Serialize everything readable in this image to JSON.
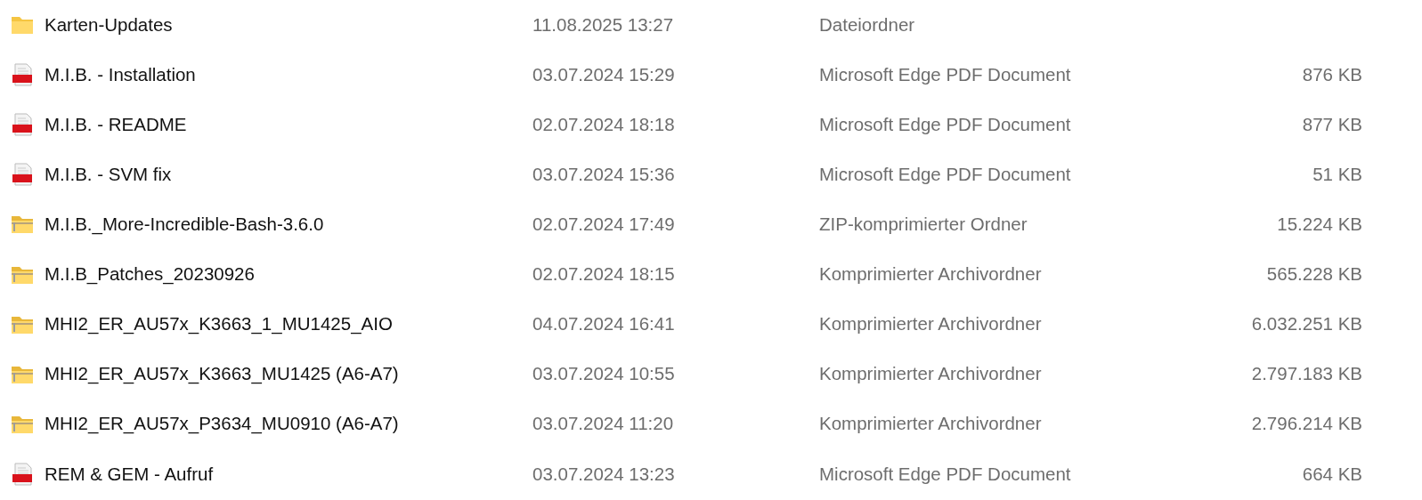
{
  "files": [
    {
      "kind": "folder",
      "name": "Karten-Updates",
      "date": "11.08.2025 13:27",
      "type": "Dateiordner"
    },
    {
      "kind": "pdf",
      "name": "M.I.B. - Installation",
      "date": "03.07.2024 15:29",
      "type": "Microsoft Edge PDF Document",
      "size": "876 KB"
    },
    {
      "kind": "pdf",
      "name": "M.I.B. - README",
      "date": "02.07.2024 18:18",
      "type": "Microsoft Edge PDF Document",
      "size": "877 KB"
    },
    {
      "kind": "pdf",
      "name": "M.I.B. - SVM fix",
      "date": "03.07.2024 15:36",
      "type": "Microsoft Edge PDF Document",
      "size": "51 KB"
    },
    {
      "kind": "zip",
      "name": "M.I.B._More-Incredible-Bash-3.6.0",
      "date": "02.07.2024 17:49",
      "type": "ZIP-komprimierter Ordner",
      "size": "15.224 KB"
    },
    {
      "kind": "zip",
      "name": "M.I.B_Patches_20230926",
      "date": "02.07.2024 18:15",
      "type": "Komprimierter Archivordner",
      "size": "565.228 KB"
    },
    {
      "kind": "zip",
      "name": "MHI2_ER_AU57x_K3663_1_MU1425_AIO",
      "date": "04.07.2024 16:41",
      "type": "Komprimierter Archivordner",
      "size": "6.032.251 KB"
    },
    {
      "kind": "zip",
      "name": "MHI2_ER_AU57x_K3663_MU1425 (A6-A7)",
      "date": "03.07.2024 10:55",
      "type": "Komprimierter Archivordner",
      "size": "2.797.183 KB"
    },
    {
      "kind": "zip",
      "name": "MHI2_ER_AU57x_P3634_MU0910 (A6-A7)",
      "date": "03.07.2024 11:20",
      "type": "Komprimierter Archivordner",
      "size": "2.796.214 KB"
    },
    {
      "kind": "pdf",
      "name": "REM & GEM - Aufruf",
      "date": "03.07.2024 13:23",
      "type": "Microsoft Edge PDF Document",
      "size": "664 KB"
    }
  ]
}
